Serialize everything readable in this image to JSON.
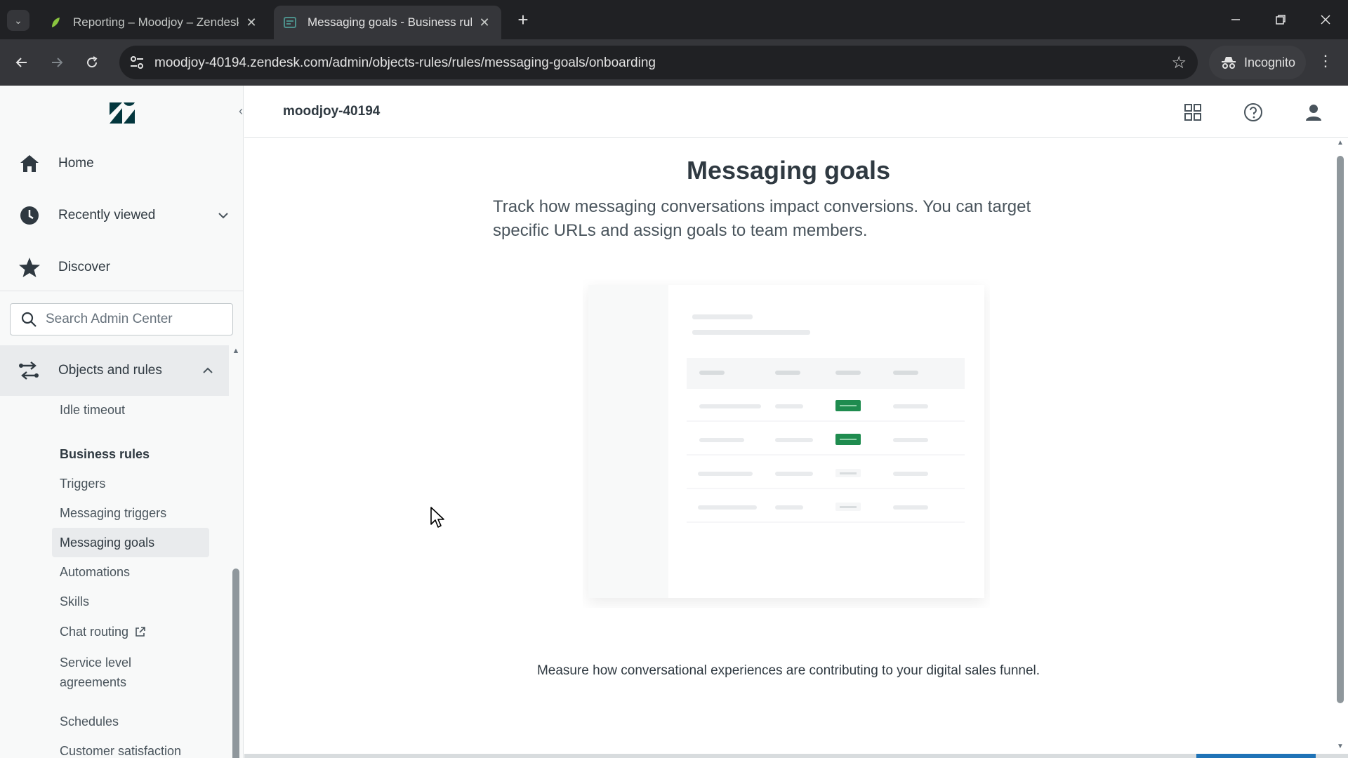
{
  "browser": {
    "tabs": [
      {
        "title": "Reporting – Moodjoy – Zendesk",
        "active": false,
        "favicon": "zendesk-leaf-icon"
      },
      {
        "title": "Messaging goals - Business rules",
        "active": true,
        "favicon": "zendesk-admin-icon"
      }
    ],
    "url": "moodjoy-40194.zendesk.com/admin/objects-rules/rules/messaging-goals/onboarding",
    "incognito_label": "Incognito"
  },
  "sidebar": {
    "top_items": [
      {
        "label": "Home",
        "icon": "home-icon"
      },
      {
        "label": "Recently viewed",
        "icon": "clock-icon"
      },
      {
        "label": "Discover",
        "icon": "star-icon"
      }
    ],
    "search_placeholder": "Search Admin Center",
    "section": {
      "label": "Objects and rules",
      "icon": "objects-rules-icon"
    },
    "sub_items": {
      "idle_timeout": "Idle timeout",
      "business_rules": "Business rules",
      "triggers": "Triggers",
      "messaging_triggers": "Messaging triggers",
      "messaging_goals": "Messaging goals",
      "automations": "Automations",
      "skills": "Skills",
      "chat_routing": "Chat routing",
      "sla_line1": "Service level",
      "sla_line2": "agreements",
      "schedules": "Schedules",
      "customer_satisfaction": "Customer satisfaction"
    },
    "active_item": "Messaging goals"
  },
  "header": {
    "account": "moodjoy-40194"
  },
  "main": {
    "title": "Messaging goals",
    "description": "Track how messaging conversations impact conversions. You can target specific URLs and assign goals to team members.",
    "footer": "Measure how conversational experiences are contributing to your digital sales funnel."
  },
  "colors": {
    "accent_green": "#1f8c4f",
    "sidebar_bg": "#f8f9f9",
    "chrome_dark": "#202124"
  }
}
